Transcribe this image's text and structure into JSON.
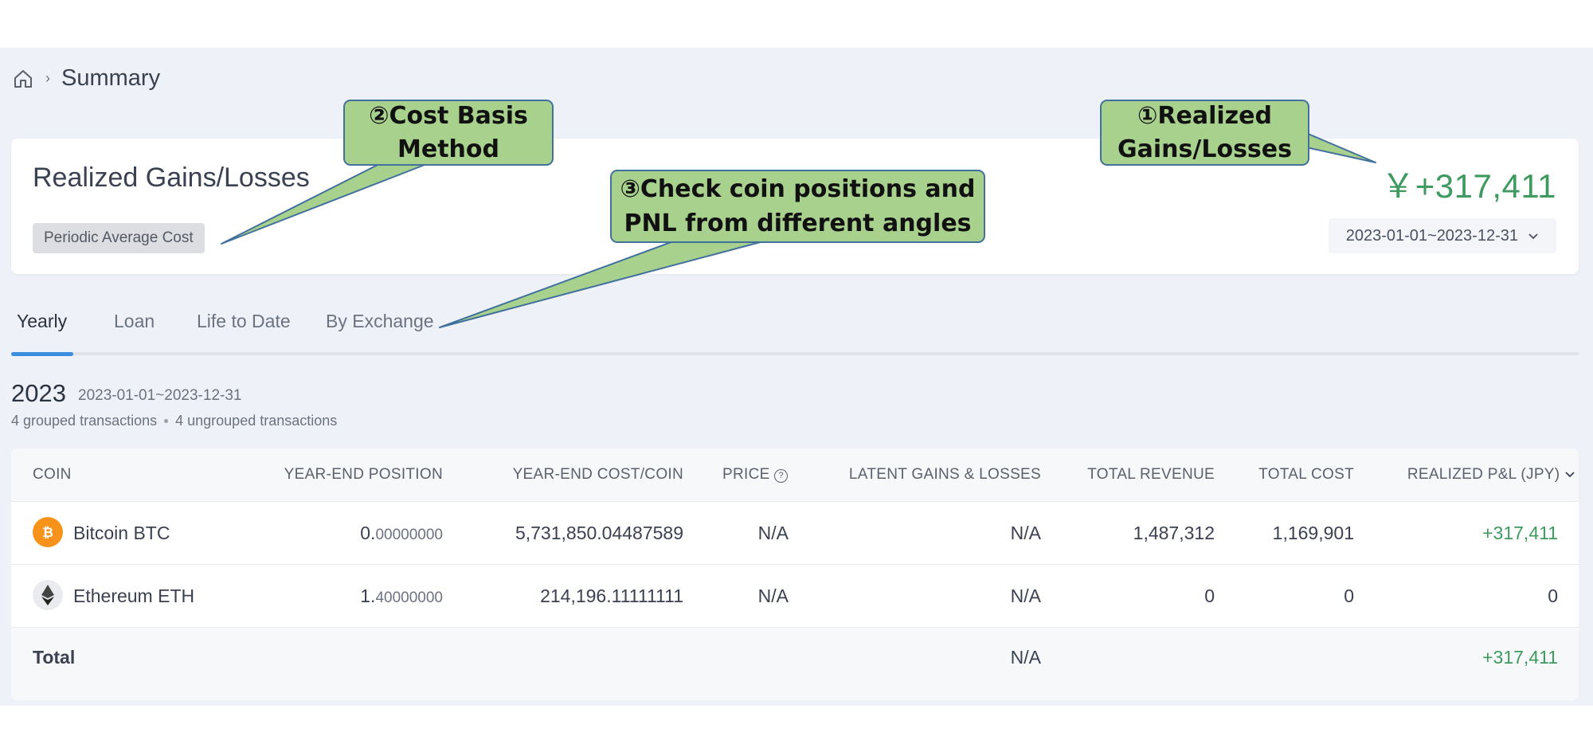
{
  "breadcrumb": {
    "home_icon": "home-icon",
    "title": "Summary"
  },
  "summary": {
    "heading": "Realized Gains/Losses",
    "method": "Periodic Average Cost",
    "amount": "￥+317,411",
    "date_range": "2023-01-01~2023-12-31"
  },
  "tabs": [
    "Yearly",
    "Loan",
    "Life to Date",
    "By Exchange"
  ],
  "active_tab": "Yearly",
  "section": {
    "year": "2023",
    "range": "2023-01-01~2023-12-31",
    "grouped": "4 grouped transactions",
    "ungrouped": "4 ungrouped transactions"
  },
  "table": {
    "headers": [
      "COIN",
      "YEAR-END POSITION",
      "YEAR-END COST/COIN",
      "PRICE",
      "LATENT GAINS & LOSSES",
      "TOTAL REVENUE",
      "TOTAL COST",
      "REALIZED P&L (JPY)"
    ],
    "rows": [
      {
        "name": "Bitcoin",
        "symbol": "BTC",
        "icon": "bitcoin-icon",
        "pos_int": "0.",
        "pos_dec": "00000000",
        "cost": "5,731,850.04487589",
        "price": "N/A",
        "latent": "N/A",
        "revenue": "1,487,312",
        "total_cost": "1,169,901",
        "pnl": "+317,411"
      },
      {
        "name": "Ethereum",
        "symbol": "ETH",
        "icon": "ethereum-icon",
        "pos_int": "1.",
        "pos_dec": "40000000",
        "cost": "214,196.11111111",
        "price": "N/A",
        "latent": "N/A",
        "revenue": "0",
        "total_cost": "0",
        "pnl": "0"
      }
    ],
    "total": {
      "label": "Total",
      "latent": "N/A",
      "pnl": "+317,411"
    }
  },
  "callouts": {
    "c1_line1": "①Realized",
    "c1_line2": "Gains/Losses",
    "c2_line1": "②Cost Basis",
    "c2_line2": "Method",
    "c3_line1": "③Check coin positions and",
    "c3_line2": "PNL from different angles"
  },
  "colors": {
    "positive": "#3f9a5f",
    "tab_indicator": "#3b8de0",
    "callout_fill": "#a9d18e",
    "callout_border": "#41719c",
    "btc": "#f7931a"
  }
}
